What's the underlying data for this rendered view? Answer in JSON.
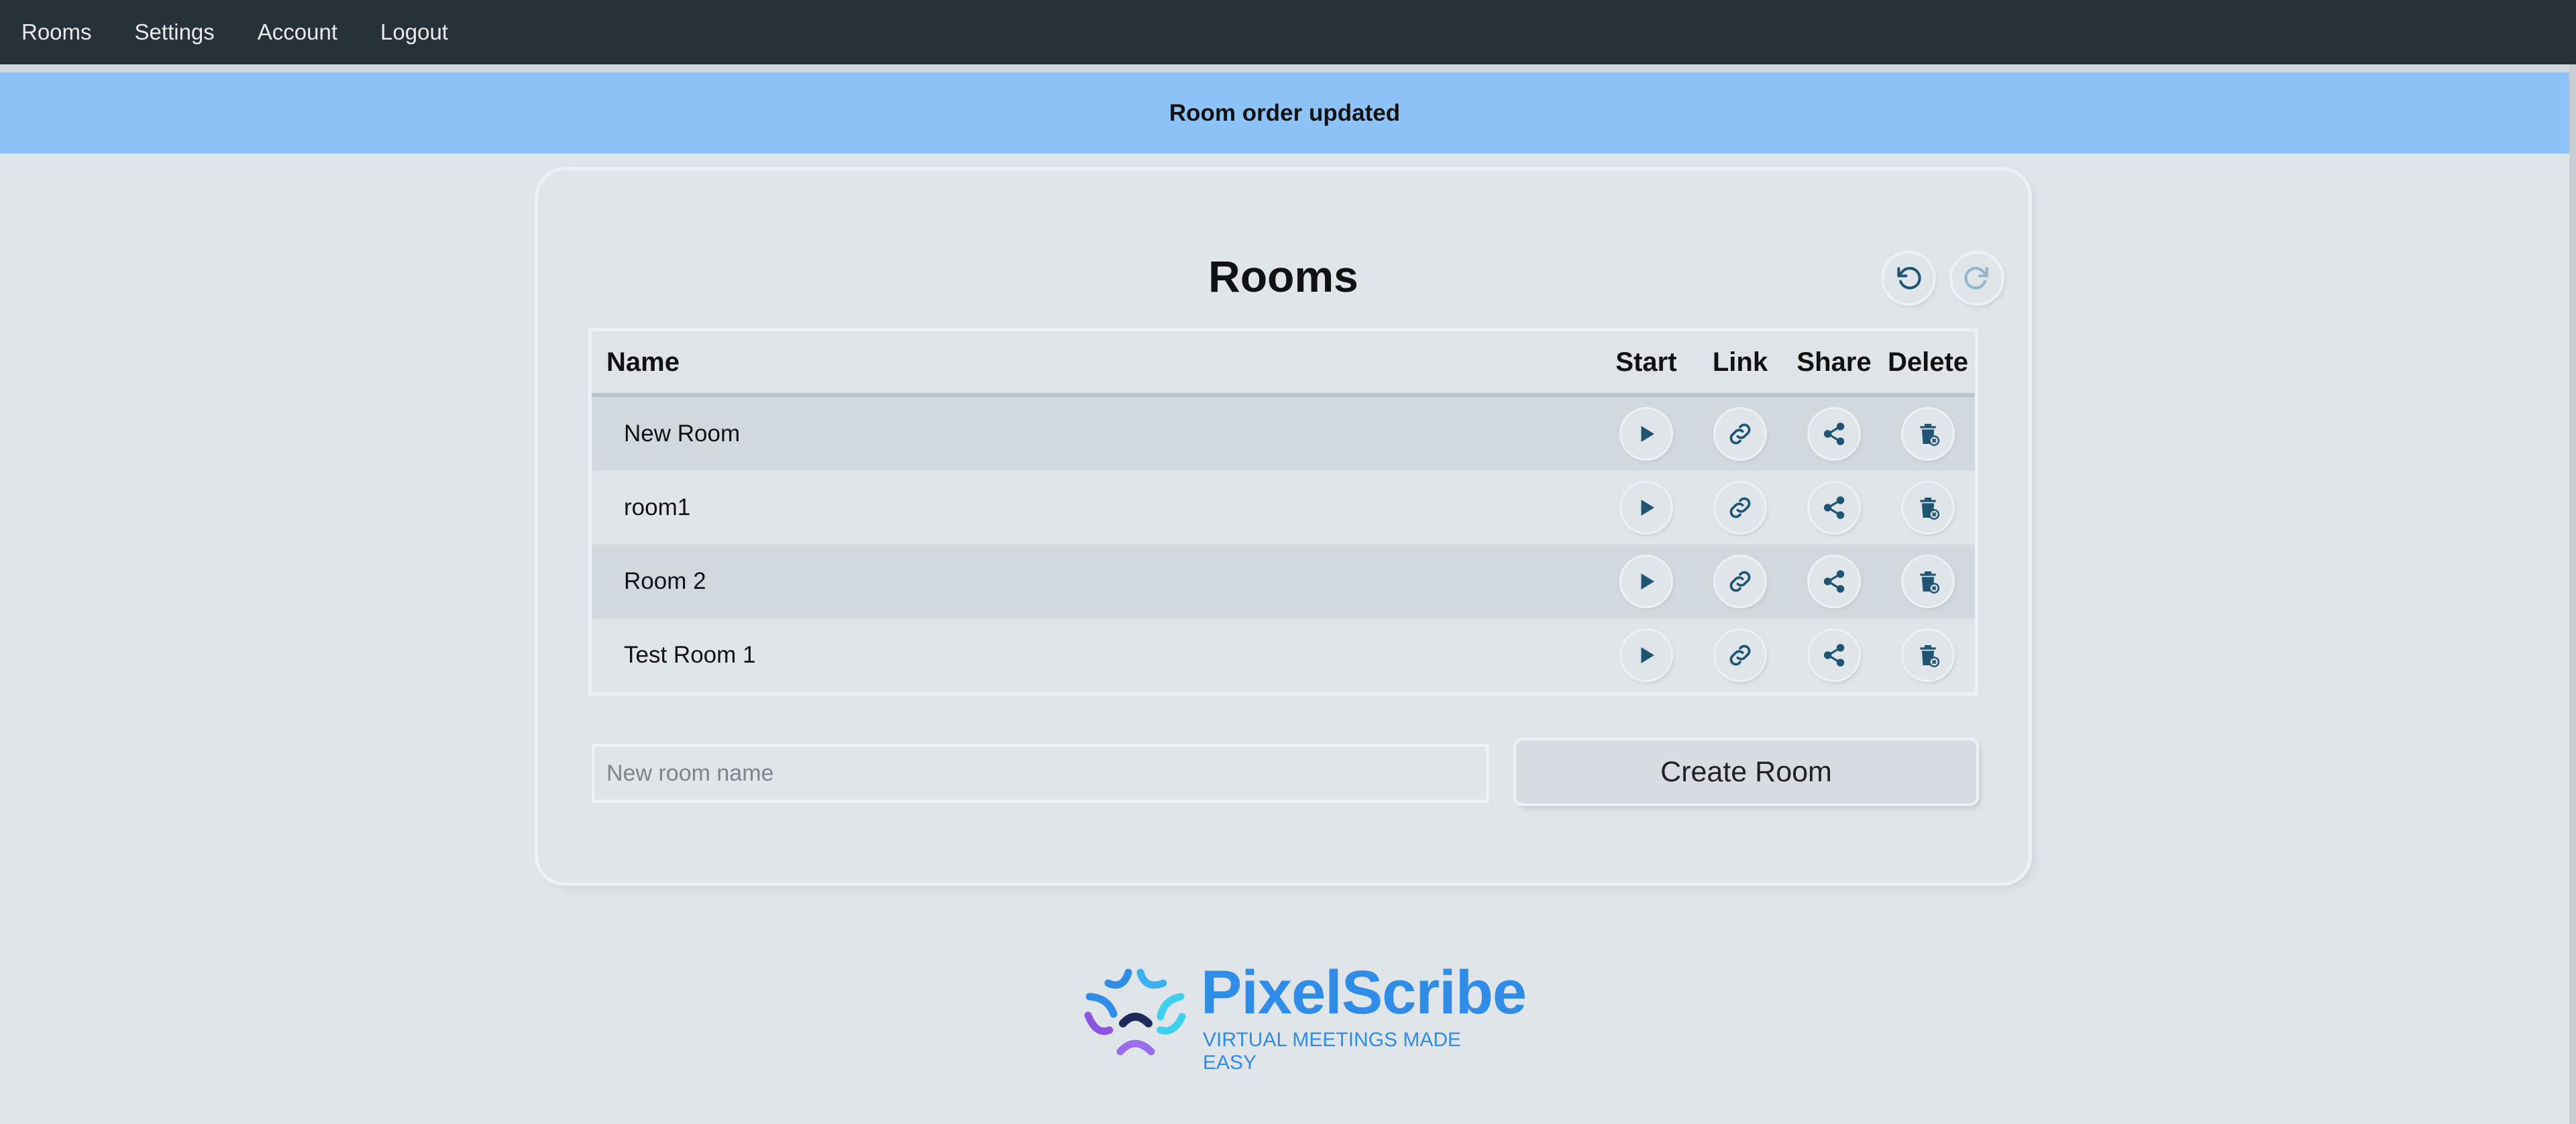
{
  "nav": {
    "items": [
      "Rooms",
      "Settings",
      "Account",
      "Logout"
    ]
  },
  "banner": {
    "message": "Room order updated"
  },
  "card": {
    "title": "Rooms",
    "undo_icon": "undo-icon",
    "redo_icon": "redo-icon"
  },
  "table": {
    "headers": {
      "name": "Name",
      "start": "Start",
      "link": "Link",
      "share": "Share",
      "delete": "Delete"
    },
    "rows": [
      {
        "name": "New Room"
      },
      {
        "name": "room1"
      },
      {
        "name": "Room 2"
      },
      {
        "name": "Test Room 1"
      }
    ],
    "row_icons": [
      "play-icon",
      "link-icon",
      "share-icon",
      "delete-icon"
    ]
  },
  "new_room": {
    "placeholder": "New room name",
    "value": ""
  },
  "create_button": {
    "label": "Create Room"
  },
  "brand": {
    "name": "PixelScribe",
    "tagline": "VIRTUAL MEETINGS MADE EASY"
  },
  "colors": {
    "nav_bg": "#273238",
    "banner_bg": "#8ec3f7",
    "icon": "#1f5573",
    "brand": "#2f8de8"
  }
}
